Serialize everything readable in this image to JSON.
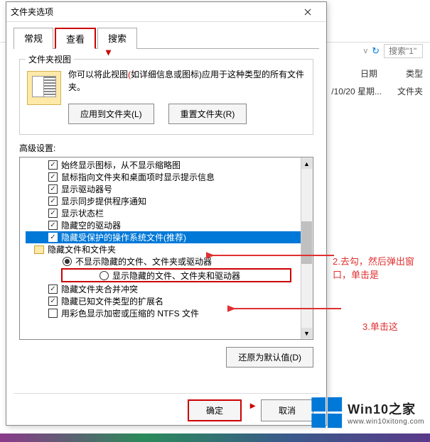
{
  "bg": {
    "search_placeholder": "搜索\"1\"",
    "col_date": "日期",
    "col_type": "类型",
    "row_date": "/10/20 星期...",
    "row_type": "文件夹"
  },
  "dialog": {
    "title": "文件夹选项",
    "tabs": {
      "general": "常规",
      "view": "查看",
      "search": "搜索"
    },
    "view_group": {
      "label": "文件夹视图",
      "desc1": "你可以将此视图",
      "desc_red": "(",
      "desc2": "如详细信息或图标)应用于这种类型的所有文件夹。",
      "btn_apply": "应用到文件夹(L)",
      "btn_reset": "重置文件夹(R)"
    },
    "adv_label": "高级设置:",
    "tree": [
      {
        "type": "check",
        "checked": true,
        "label": "始终显示图标，从不显示缩略图"
      },
      {
        "type": "check",
        "checked": true,
        "label": "鼠标指向文件夹和桌面项时显示提示信息"
      },
      {
        "type": "check",
        "checked": true,
        "label": "显示驱动器号"
      },
      {
        "type": "check",
        "checked": true,
        "label": "显示同步提供程序通知"
      },
      {
        "type": "check",
        "checked": true,
        "label": "显示状态栏"
      },
      {
        "type": "check",
        "checked": true,
        "label": "隐藏空的驱动器"
      },
      {
        "type": "check",
        "checked": true,
        "hl": true,
        "label": "隐藏受保护的操作系统文件(推荐)"
      },
      {
        "type": "folder",
        "label": "隐藏文件和文件夹"
      },
      {
        "type": "radio",
        "checked": true,
        "indent": 2,
        "label": "不显示隐藏的文件、文件夹或驱动器"
      },
      {
        "type": "radio",
        "checked": false,
        "indent": 2,
        "boxed": true,
        "label": "显示隐藏的文件、文件夹和驱动器"
      },
      {
        "type": "check",
        "checked": true,
        "label": "隐藏文件夹合并冲突"
      },
      {
        "type": "check",
        "checked": true,
        "label": "隐藏已知文件类型的扩展名"
      },
      {
        "type": "check",
        "checked": false,
        "label": "用彩色显示加密或压缩的 NTFS 文件"
      }
    ],
    "btn_restore": "还原为默认值(D)",
    "btn_ok": "确定",
    "btn_cancel": "取消"
  },
  "annotations": {
    "a2": "2.去勾，然后弹出窗口，单击是",
    "a3": "3.单击这"
  },
  "logo": {
    "t1": "Win10之家",
    "t2": "www.win10xitong.com"
  }
}
